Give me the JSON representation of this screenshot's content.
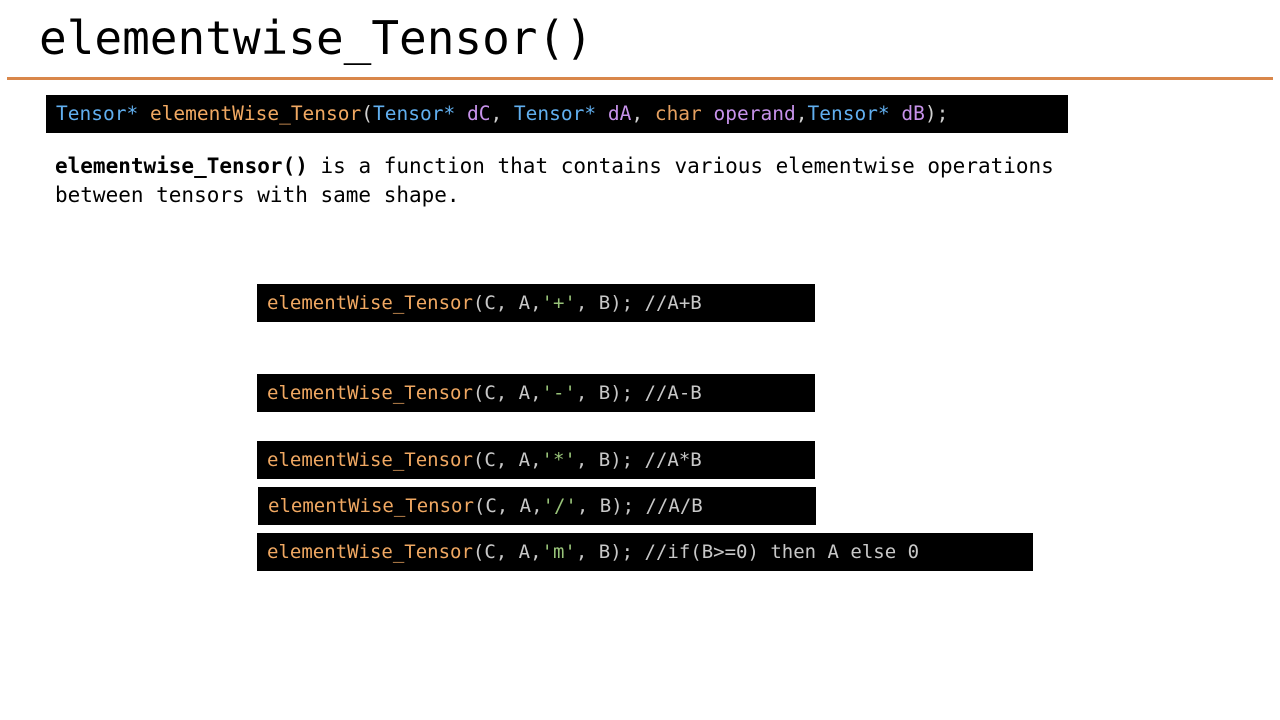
{
  "slide": {
    "title": "elementwise_Tensor()",
    "accent_color": "#d9874a"
  },
  "signature": {
    "return_type": "Tensor*",
    "fn_name": "elementWise_Tensor",
    "open_paren": "(",
    "p1_type": "Tensor*",
    "p1_name": "dC",
    "comma1": ", ",
    "p2_type": "Tensor*",
    "p2_name": "dA",
    "comma2": ", ",
    "p3_type": "char",
    "p3_name": "operand",
    "comma3": ",",
    "p4_type": "Tensor*",
    "p4_name": "dB",
    "close": ");"
  },
  "description": {
    "bold": "elementwise_Tensor()",
    "text": " is a function that contains various elementwise operations between tensors with same shape."
  },
  "examples": [
    {
      "fn": "elementWise_Tensor",
      "pre": "(C, A,",
      "op": "'+'",
      "post": ", B); //A+B"
    },
    {
      "fn": "elementWise_Tensor",
      "pre": "(C, A,",
      "op": "'-'",
      "post": ", B); //A-B"
    },
    {
      "fn": "elementWise_Tensor",
      "pre": "(C, A,",
      "op": "'*'",
      "post": ", B); //A*B"
    },
    {
      "fn": "elementWise_Tensor",
      "pre": "(C, A,",
      "op": "'/'",
      "post": ", B); //A/B"
    },
    {
      "fn": "elementWise_Tensor",
      "pre": "(C, A,",
      "op": "'m'",
      "post": ", B); //if(B>=0) then A else 0"
    }
  ]
}
